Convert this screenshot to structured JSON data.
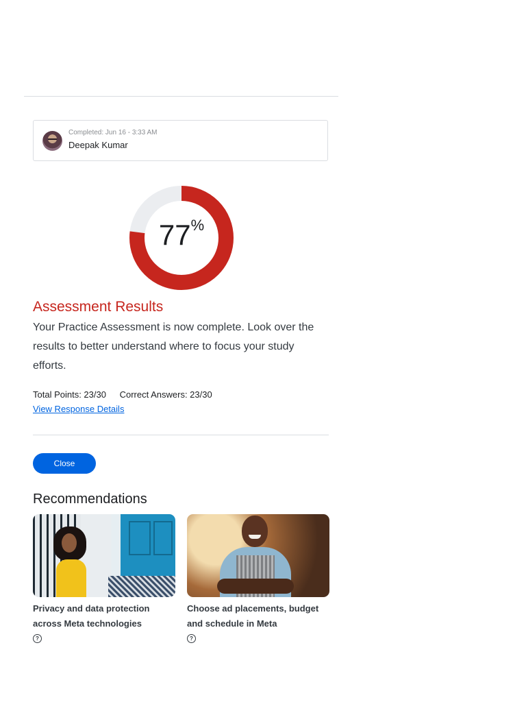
{
  "user": {
    "completed_label": "Completed: Jun 16 - 3:33 AM",
    "name": "Deepak Kumar"
  },
  "score": {
    "value": "77",
    "unit": "%",
    "fraction": 0.77,
    "ring_color": "#c6261e",
    "track_color": "#ebedf0"
  },
  "results": {
    "title": "Assessment Results",
    "description": "Your Practice Assessment is now complete. Look over the results to better understand where to focus your study efforts.",
    "total_points": "Total Points: 23/30",
    "correct_answers": "Correct Answers: 23/30",
    "view_details_link": "View Response Details"
  },
  "close_button": "Close",
  "recommendations": {
    "title": "Recommendations",
    "cards": [
      {
        "title": "Privacy and data protection across Meta technologies",
        "icon": "help-circle-icon"
      },
      {
        "title": "Choose ad placements, budget and schedule in Meta",
        "icon": "help-circle-icon"
      }
    ]
  },
  "colors": {
    "accent_red": "#c6261e",
    "primary_blue": "#0064e0"
  }
}
